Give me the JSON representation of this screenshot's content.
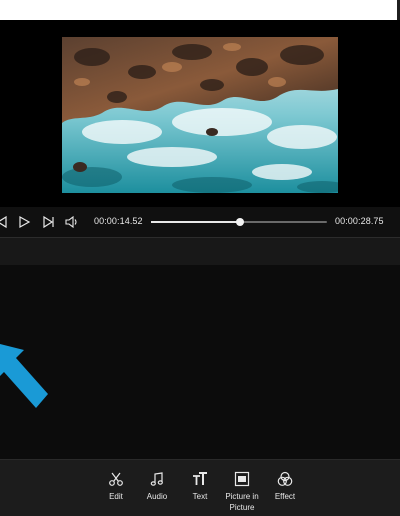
{
  "player": {
    "current_time": "00:00:14.52",
    "total_time": "00:00:28.75",
    "progress": 0.505
  },
  "toolbar": {
    "edit_label": "Edit",
    "audio_label": "Audio",
    "text_label": "Text",
    "pip_label": "Picture in Picture",
    "effect_label": "Effect"
  },
  "colors": {
    "accent_arrow": "#1a9ad6",
    "background": "#000000",
    "panel": "#1c1c1c"
  }
}
